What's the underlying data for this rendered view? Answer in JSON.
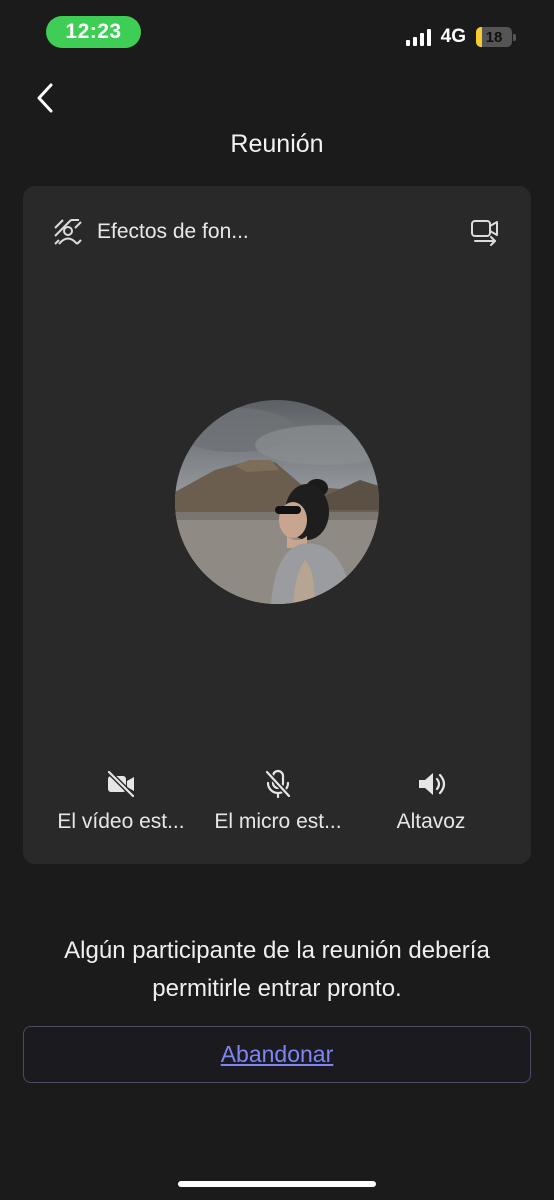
{
  "status_bar": {
    "time": "12:23",
    "network": "4G",
    "battery_level": "18",
    "time_pill_color": "#3fce55",
    "battery_color": "#f7cc2e"
  },
  "header": {
    "back_icon": "chevron-left-icon",
    "title": "Reunión"
  },
  "preview": {
    "effects_label": "Efectos de fon...",
    "effects_icon": "background-effects-icon",
    "switch_camera_icon": "switch-camera-icon",
    "avatar": "profile-photo"
  },
  "controls": [
    {
      "icon": "video-off-icon",
      "label": "El vídeo est..."
    },
    {
      "icon": "mic-off-icon",
      "label": "El micro est..."
    },
    {
      "icon": "speaker-icon",
      "label": "Altavoz"
    }
  ],
  "notice": "Algún participante de la reunión debería permitirle entrar pronto.",
  "leave_button": {
    "label": "Abandonar",
    "color": "#7f85f5"
  }
}
